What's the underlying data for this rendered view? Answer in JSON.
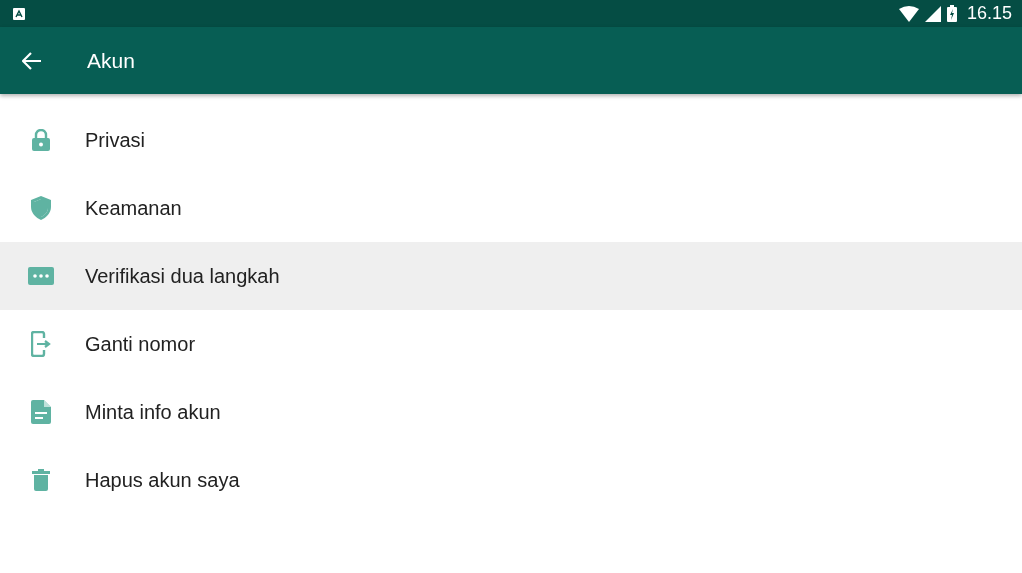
{
  "status_bar": {
    "time": "16.15"
  },
  "app_bar": {
    "title": "Akun"
  },
  "items": [
    {
      "kind": "lock",
      "label": "Privasi",
      "selected": false
    },
    {
      "kind": "shield",
      "label": "Keamanan",
      "selected": false
    },
    {
      "kind": "dots",
      "label": "Verifikasi dua langkah",
      "selected": true
    },
    {
      "kind": "phone-exit",
      "label": "Ganti nomor",
      "selected": false
    },
    {
      "kind": "document",
      "label": "Minta info akun",
      "selected": false
    },
    {
      "kind": "trash",
      "label": "Hapus akun saya",
      "selected": false
    }
  ]
}
